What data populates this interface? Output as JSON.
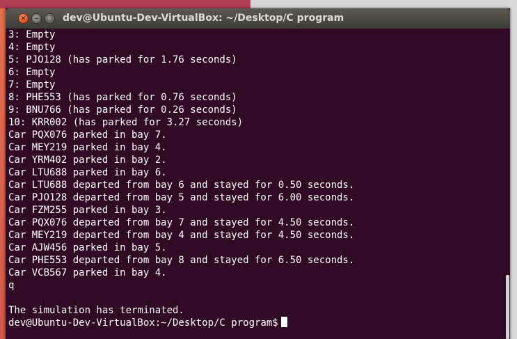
{
  "window": {
    "title": "dev@Ubuntu-Dev-VirtualBox: ~/Desktop/C program",
    "close_glyph": "×",
    "minimize_glyph": "–",
    "maximize_glyph": "□"
  },
  "terminal": {
    "lines": [
      "3: Empty",
      "4: Empty",
      "5: PJO128 (has parked for 1.76 seconds)",
      "6: Empty",
      "7: Empty",
      "8: PHE553 (has parked for 0.76 seconds)",
      "9: BNU766 (has parked for 0.26 seconds)",
      "10: KRR002 (has parked for 3.27 seconds)",
      "Car PQX076 parked in bay 7.",
      "Car MEY219 parked in bay 4.",
      "Car YRM402 parked in bay 2.",
      "Car LTU688 parked in bay 6.",
      "Car LTU688 departed from bay 6 and stayed for 0.50 seconds.",
      "Car PJO128 departed from bay 5 and stayed for 6.00 seconds.",
      "Car FZM255 parked in bay 3.",
      "Car PQX076 departed from bay 7 and stayed for 4.50 seconds.",
      "Car MEY219 departed from bay 4 and stayed for 4.50 seconds.",
      "Car AJW456 parked in bay 5.",
      "Car PHE553 departed from bay 8 and stayed for 6.50 seconds.",
      "Car VCB567 parked in bay 4.",
      "q",
      "",
      "The simulation has terminated."
    ],
    "prompt": "dev@Ubuntu-Dev-VirtualBox:~/Desktop/C program$"
  },
  "colors": {
    "terminal_bg": "#300a24",
    "terminal_fg": "#ffffff",
    "close_button": "#e9572a",
    "titlebar": "#3c3b37"
  },
  "icons": {
    "close": "close-icon",
    "minimize": "minimize-icon",
    "maximize": "maximize-icon"
  }
}
